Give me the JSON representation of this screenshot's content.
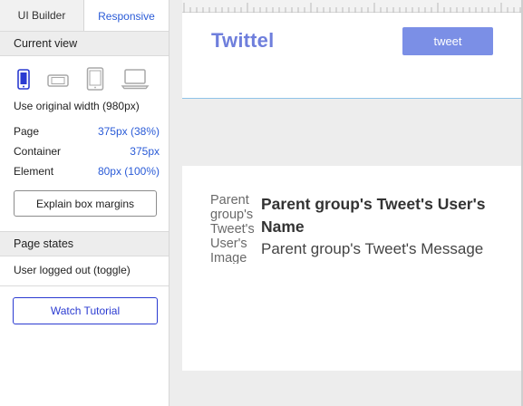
{
  "tabs": {
    "builder": "UI Builder",
    "responsive": "Responsive"
  },
  "current_view": {
    "heading": "Current view",
    "devices": [
      "phone-icon",
      "phone-landscape-icon",
      "tablet-icon",
      "laptop-icon"
    ],
    "original_width": "Use original width (980px)",
    "rows": [
      {
        "label": "Page",
        "value": "375px (38%)"
      },
      {
        "label": "Container",
        "value": "375px"
      },
      {
        "label": "Element",
        "value": "80px (100%)"
      }
    ],
    "explain_button": "Explain box margins"
  },
  "page_states": {
    "heading": "Page states",
    "state": "User logged out (toggle)",
    "tutorial_button": "Watch Tutorial"
  },
  "canvas": {
    "logo": "Twittel",
    "tweet_button": "tweet",
    "user_image_alt": "Parent group's Tweet's User's Image",
    "user_name": "Parent group's Tweet's User's Name",
    "message": "Parent group's Tweet's Message"
  },
  "colors": {
    "accent_blue": "#2a5bd7",
    "logo": "#6f7fdc",
    "tweet_button": "#7b8fe6",
    "active_device": "#2b3bd1"
  }
}
